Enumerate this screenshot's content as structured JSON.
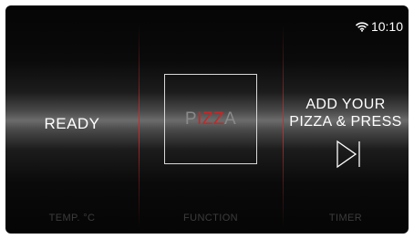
{
  "status_bar": {
    "time": "10:10",
    "wifi_icon": "wifi-icon"
  },
  "left_section": {
    "status_text": "READY",
    "label": "TEMP. °C"
  },
  "center_section": {
    "function_logo": {
      "part1": "P",
      "part2": "IZZ",
      "part3": "A"
    },
    "label": "FUNCTION"
  },
  "right_section": {
    "message_line1": "ADD YOUR",
    "message_line2": "PIZZA & PRESS",
    "action_icon": "skip-next-icon",
    "label": "TIMER"
  },
  "colors": {
    "accent_red": "#c42828",
    "divider_red": "#e12323",
    "text_white": "#ffffff",
    "label_grey": "#3c3c3c"
  }
}
